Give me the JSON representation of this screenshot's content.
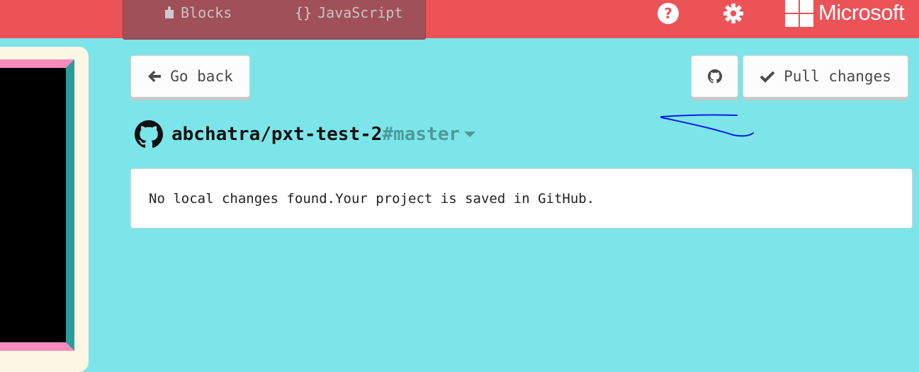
{
  "header": {
    "editor_toggle": {
      "blocks_label": "Blocks",
      "javascript_label": "JavaScript",
      "blocks_icon": "puzzle-icon",
      "javascript_icon": "braces-icon"
    },
    "help_icon": "help-icon",
    "settings_icon": "gear-icon",
    "brand": "Microsoft",
    "background_color": "#ec5357"
  },
  "toolbar": {
    "go_back_label": "Go back",
    "github_icon": "github-icon",
    "pull_label": "Pull changes"
  },
  "repo": {
    "name": "abchatra/pxt-test-2",
    "branch": "#master"
  },
  "status": {
    "message": "No local changes found.Your project is saved in GitHub."
  },
  "colors": {
    "page_background": "#7ce5e9",
    "accent_red": "#ec5357",
    "annotation_ink": "#0a1ee0"
  }
}
